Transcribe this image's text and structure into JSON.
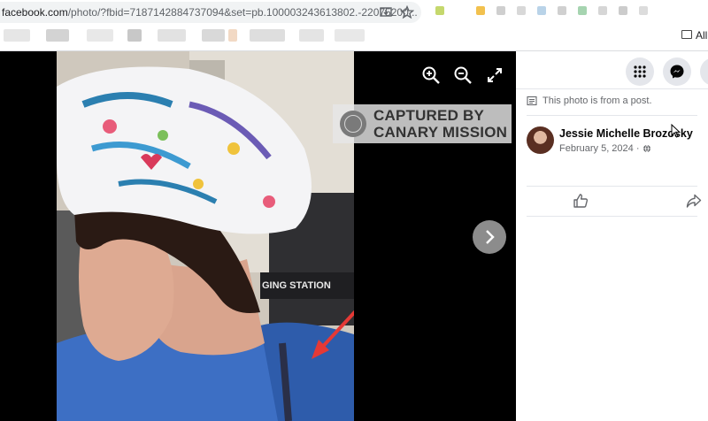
{
  "browser": {
    "url_host": "facebook.com",
    "url_rest": "/photo/?fbid=7187142884737094&set=pb.100003243613802.-22075200...",
    "bookmarks_all_label": "All"
  },
  "viewer": {
    "watermark_line1": "CAPTURED BY",
    "watermark_line2": "CANARY MISSION",
    "controls": [
      "zoom-in-icon",
      "zoom-out-icon",
      "fullscreen-icon"
    ],
    "photo_sign_text": "GING STATION"
  },
  "panel": {
    "post_note": "This photo is from a post.",
    "author_name": "Jessie Michelle Brozosky",
    "post_date": "February 5, 2024 ·",
    "top_icons": [
      "menu-grid-icon",
      "messenger-icon",
      "notifications-bell-icon"
    ]
  },
  "colors": {
    "viewer_bg": "#000000",
    "panel_bg": "#ffffff",
    "button_bg": "#e4e6eb",
    "secondary_text": "#65676b",
    "arrow_red": "#e53935"
  }
}
